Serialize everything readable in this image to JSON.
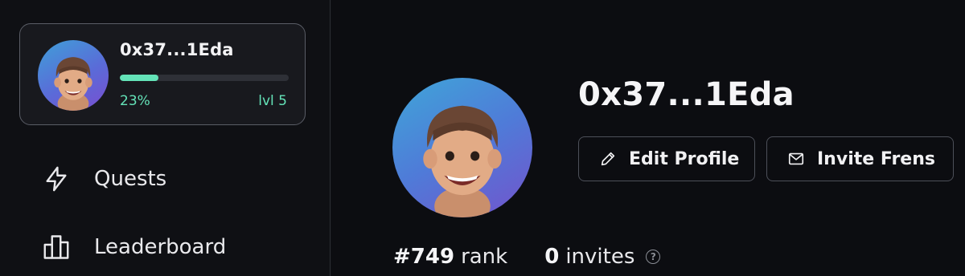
{
  "user": {
    "address": "0x37...1Eda",
    "progress_percent": 23,
    "progress_label": "23%",
    "level_label": "lvl 5"
  },
  "nav": {
    "items": [
      {
        "label": "Quests",
        "icon": "lightning-icon"
      },
      {
        "label": "Leaderboard",
        "icon": "leaderboard-icon"
      }
    ]
  },
  "profile": {
    "address": "0x37...1Eda",
    "edit_label": "Edit Profile",
    "invite_label": "Invite Frens",
    "rank_value": "#749",
    "rank_label": "rank",
    "invites_value": "0",
    "invites_label": "invites",
    "help_symbol": "?"
  },
  "colors": {
    "accent": "#64e3b8",
    "background": "#0f1014",
    "avatar_gradient_start": "#3fa0d8",
    "avatar_gradient_end": "#7a4ed0"
  }
}
